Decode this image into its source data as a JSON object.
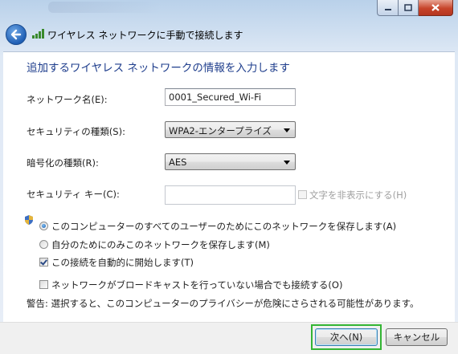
{
  "window": {
    "title": "ワイヤレス ネットワークに手動で接続します"
  },
  "content": {
    "heading": "追加するワイヤレス ネットワークの情報を入力します",
    "network_name_label": "ネットワーク名(E):",
    "network_name_value": "0001_Secured_Wi-Fi",
    "security_type_label": "セキュリティの種類(S):",
    "security_type_value": "WPA2-エンタープライズ",
    "encryption_type_label": "暗号化の種類(R):",
    "encryption_type_value": "AES",
    "security_key_label": "セキュリティ キー(C):",
    "security_key_value": "",
    "hide_characters_label": "文字を非表示にする(H)",
    "save_all_users_label": "このコンピューターのすべてのユーザーのためにこのネットワークを保存します(A)",
    "save_me_only_label": "自分のためにのみこのネットワークを保存します(M)",
    "auto_connect_label": "この接続を自動的に開始します(T)",
    "connect_hidden_label": "ネットワークがブロードキャストを行っていない場合でも接続する(O)",
    "warning_text": "警告: 選択すると、このコンピューターのプライバシーが危険にさらされる可能性があります。"
  },
  "footer": {
    "next_label": "次へ(N)",
    "cancel_label": "キャンセル"
  },
  "state": {
    "save_scope": "all-users",
    "auto_connect_checked": true,
    "connect_hidden_checked": false,
    "hide_characters_checked": false,
    "hide_characters_enabled": false
  },
  "colors": {
    "heading": "#1e3d8c",
    "focus_highlight": "#34b534",
    "close_button": "#c7442a"
  },
  "icons": [
    "back-arrow-icon",
    "wifi-signal-icon",
    "shield-icon",
    "minimize-icon",
    "maximize-icon",
    "close-icon",
    "dropdown-arrow-icon"
  ]
}
